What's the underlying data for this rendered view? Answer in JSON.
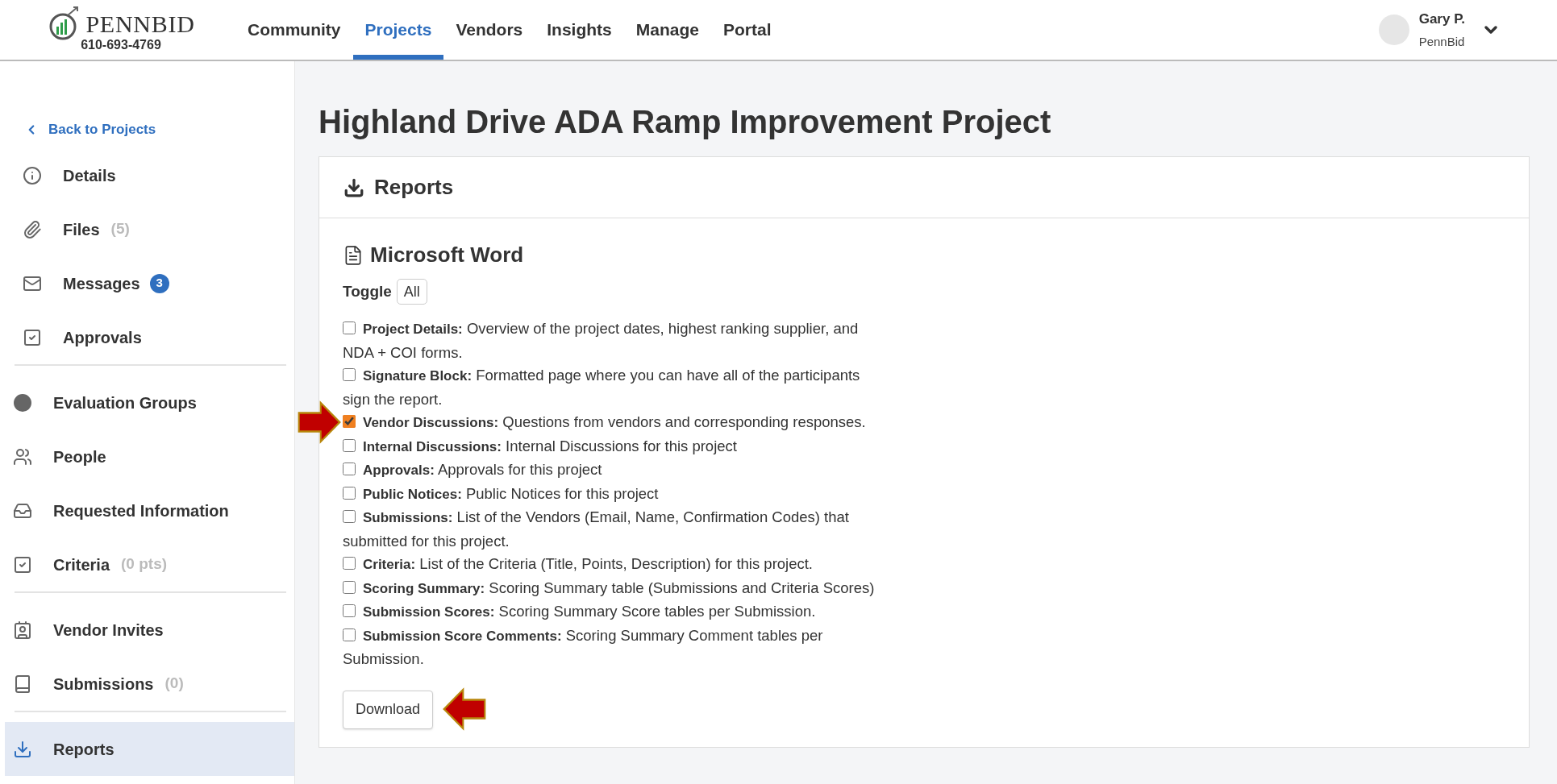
{
  "header": {
    "logo_text": "PENNBID",
    "phone": "610-693-4769",
    "nav": [
      {
        "label": "Community",
        "selected": false
      },
      {
        "label": "Projects",
        "selected": true
      },
      {
        "label": "Vendors",
        "selected": false
      },
      {
        "label": "Insights",
        "selected": false
      },
      {
        "label": "Manage",
        "selected": false
      },
      {
        "label": "Portal",
        "selected": false
      }
    ],
    "user": {
      "name": "Gary P.",
      "org": "PennBid"
    }
  },
  "sidebar": {
    "back": "Back to Projects",
    "groups": [
      [
        {
          "label": "Details",
          "selected": false
        },
        {
          "label": "Files",
          "count": "(5)",
          "selected": false
        },
        {
          "label": "Messages",
          "badge": "3",
          "selected": false
        },
        {
          "label": "Approvals",
          "selected": false
        }
      ],
      [
        {
          "label": "Evaluation Groups",
          "selected": false
        },
        {
          "label": "People",
          "selected": false
        },
        {
          "label": "Requested Information",
          "selected": false
        },
        {
          "label": "Criteria",
          "count": "(0 pts)",
          "selected": false
        }
      ],
      [
        {
          "label": "Vendor Invites",
          "selected": false
        },
        {
          "label": "Submissions",
          "count": "(0)",
          "selected": false
        }
      ],
      [
        {
          "label": "Reports",
          "selected": true
        }
      ]
    ]
  },
  "page_title": "Highland Drive ADA Ramp Improvement Project",
  "card": {
    "title": "Reports",
    "section": "Microsoft Word",
    "toggle_label": "Toggle",
    "toggle_button": "All",
    "options": [
      {
        "title": "Project Details:",
        "description": "Overview of the project dates, highest ranking supplier, and NDA + COI forms.",
        "checked": false
      },
      {
        "title": "Signature Block:",
        "description": "Formatted page where you can have all of the participants sign the report.",
        "checked": false
      },
      {
        "title": "Vendor Discussions:",
        "description": "Questions from vendors and corresponding responses.",
        "checked": true
      },
      {
        "title": "Internal Discussions:",
        "description": "Internal Discussions for this project",
        "checked": false
      },
      {
        "title": "Approvals:",
        "description": "Approvals for this project",
        "checked": false
      },
      {
        "title": "Public Notices:",
        "description": "Public Notices for this project",
        "checked": false
      },
      {
        "title": "Submissions:",
        "description": "List of the Vendors (Email, Name, Confirmation Codes) that submitted for this project.",
        "checked": false
      },
      {
        "title": "Criteria:",
        "description": "List of the Criteria (Title, Points, Description) for this project.",
        "checked": false
      },
      {
        "title": "Scoring Summary:",
        "description": "Scoring Summary table (Submissions and Criteria Scores)",
        "checked": false
      },
      {
        "title": "Submission Scores:",
        "description": "Scoring Summary Score tables per Submission.",
        "checked": false
      },
      {
        "title": "Submission Score Comments:",
        "description": "Scoring Summary Comment tables per Submission.",
        "checked": false
      }
    ],
    "download": "Download"
  }
}
